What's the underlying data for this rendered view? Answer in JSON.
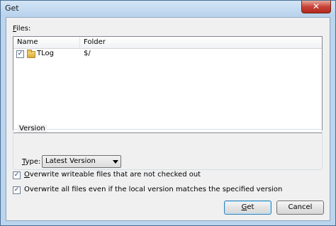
{
  "window": {
    "title": "Get",
    "close_glyph": "✕"
  },
  "files": {
    "label_prefix": "",
    "label_mnemonic": "F",
    "label_rest": "iles:",
    "columns": [
      "Name",
      "Folder"
    ],
    "rows": [
      {
        "checked": true,
        "icon": "folder-icon",
        "name": "TLog",
        "folder": "$/"
      }
    ]
  },
  "version": {
    "group_title": "Version",
    "type_mnemonic": "T",
    "type_rest": "ype:",
    "selected": "Latest Version"
  },
  "options": [
    {
      "checked": true,
      "mnemonic": "O",
      "rest": "verwrite writeable files that are not checked out"
    },
    {
      "checked": true,
      "mnemonic": "",
      "rest": "Overwrite all files even if the local version matches the specified version"
    }
  ],
  "buttons": {
    "get_mnemonic": "G",
    "get_rest": "et",
    "cancel": "Cancel"
  }
}
